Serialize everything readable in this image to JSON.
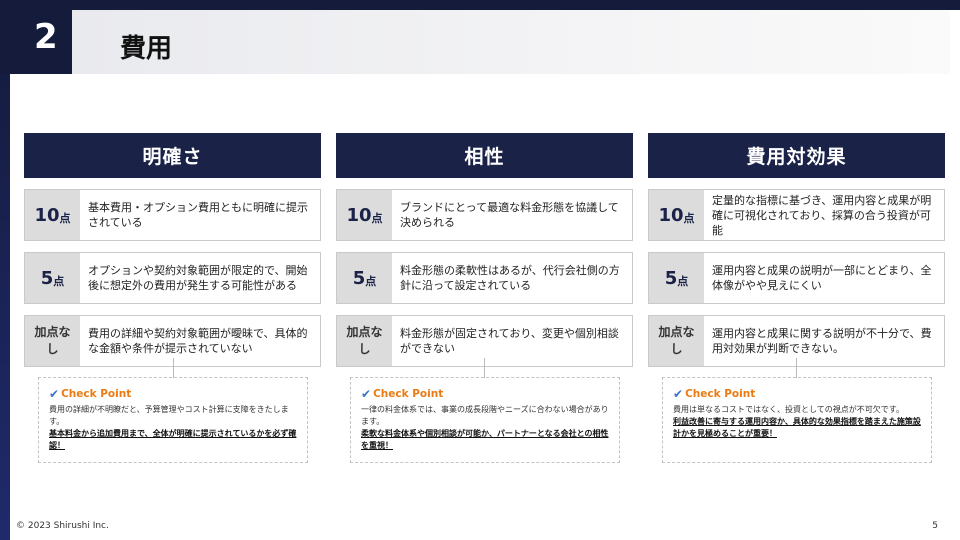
{
  "header": {
    "slide_number": "2",
    "title": "費用"
  },
  "columns": [
    {
      "heading": "明確さ",
      "rows": [
        {
          "score": "10",
          "unit": "点",
          "text": "基本費用・オプション費用ともに明確に提示されている"
        },
        {
          "score": "5",
          "unit": "点",
          "text": "オプションや契約対象範囲が限定的で、開始後に想定外の費用が発生する可能性がある"
        },
        {
          "score_label": "加点なし",
          "text": "費用の詳細や契約対象範囲が曖昧で、具体的な金額や条件が提示されていない"
        }
      ],
      "check_point": {
        "title": "Check Point",
        "body": "費用の詳細が不明瞭だと、予算管理やコスト計算に支障をきたします。",
        "emphasis": "基本料金から追加費用まで、全体が明確に提示されているかを必ず確認！"
      }
    },
    {
      "heading": "相性",
      "rows": [
        {
          "score": "10",
          "unit": "点",
          "text": "ブランドにとって最適な料金形態を協議して決められる"
        },
        {
          "score": "5",
          "unit": "点",
          "text": "料金形態の柔軟性はあるが、代行会社側の方針に沿って設定されている"
        },
        {
          "score_label": "加点なし",
          "text": "料金形態が固定されており、変更や個別相談ができない"
        }
      ],
      "check_point": {
        "title": "Check Point",
        "body": "一律の料金体系では、事業の成長段階やニーズに合わない場合があります。",
        "emphasis": "柔軟な料金体系や個別相談が可能か、パートナーとなる会社との相性を重視！"
      }
    },
    {
      "heading": "費用対効果",
      "rows": [
        {
          "score": "10",
          "unit": "点",
          "text": "定量的な指標に基づき、運用内容と成果が明確に可視化されており、採算の合う投資が可能"
        },
        {
          "score": "5",
          "unit": "点",
          "text": "運用内容と成果の説明が一部にとどまり、全体像がやや見えにくい"
        },
        {
          "score_label": "加点なし",
          "text": "運用内容と成果に関する説明が不十分で、費用対効果が判断できない。"
        }
      ],
      "check_point": {
        "title": "Check Point",
        "body": "費用は単なるコストではなく、投資としての視点が不可欠です。",
        "emphasis": "利益改善に寄与する運用内容か、具体的な効果指標を踏まえた施策設計かを見極めることが重要！"
      }
    }
  ],
  "footer": {
    "copyright": "© 2023 Shirushi Inc.",
    "page": "5"
  },
  "colors": {
    "navy": "#1a2248",
    "accent_orange": "#e97b12",
    "score_bg": "#dcdcdc"
  }
}
